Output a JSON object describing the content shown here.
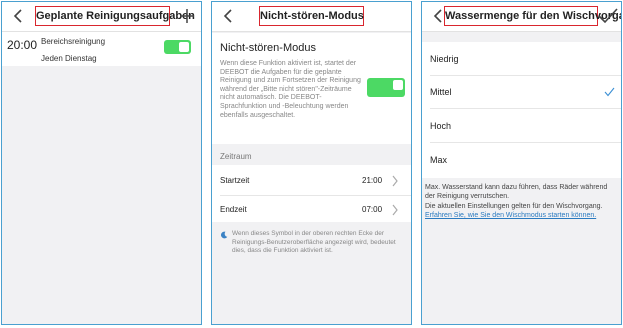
{
  "panel1": {
    "title": "Geplante Reinigungsaufgaben",
    "task": {
      "time": "20:00",
      "name": "Bereichsreinigung",
      "repeat": "Jeden Dienstag",
      "enabled": true
    }
  },
  "panel2": {
    "title": "Nicht-stören-Modus",
    "heading": "Nicht-stören-Modus",
    "description": "Wenn diese Funktion aktiviert ist, startet der DEEBOT die Aufgaben für die geplante Reinigung und zum Fortsetzen der Reinigung während der „Bitte nicht stören\"-Zeiträume nicht automatisch. Die DEEBOT-Sprachfunktion und -Beleuchtung werden ebenfalls ausgeschaltet.",
    "enabled": true,
    "section_label": "Zeitraum",
    "start_label": "Startzeit",
    "start_value": "21:00",
    "end_label": "Endzeit",
    "end_value": "07:00",
    "footnote": "Wenn dieses Symbol in der oberen rechten Ecke der Reinigungs-Benutzeroberfläche angezeigt wird, bedeutet dies, dass die Funktion aktiviert ist."
  },
  "panel3": {
    "title": "Wassermenge für den Wischvorgang",
    "options": [
      "Niedrig",
      "Mittel",
      "Hoch",
      "Max"
    ],
    "selected": "Mittel",
    "note1": "Max. Wasserstand kann dazu führen, dass Räder während der Reinigung verrutschen.",
    "note2": "Die aktuellen Einstellungen gelten für den Wischvorgang.",
    "link": "Erfahren Sie, wie Sie den Wischmodus starten können."
  },
  "colors": {
    "accent_green": "#4cd964",
    "highlight_red": "#d9262e",
    "link_blue": "#2a7ac0",
    "panel_border": "#4aa0d0"
  },
  "icons": [
    "back-arrow-icon",
    "plus-icon",
    "checkmark-icon",
    "chevron-right-icon",
    "moon-icon"
  ]
}
